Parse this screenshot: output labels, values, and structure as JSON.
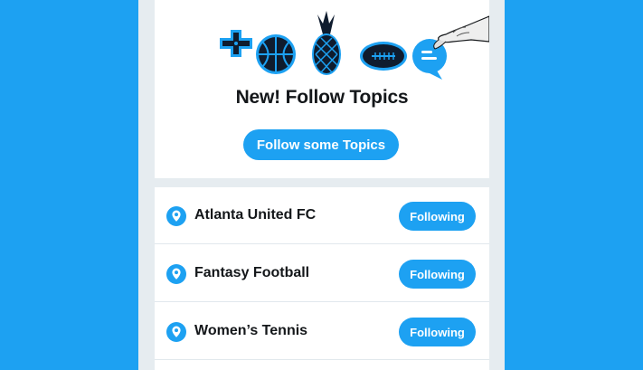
{
  "promo": {
    "headline": "New! Follow Topics",
    "cta_label": "Follow some Topics",
    "icons": [
      "gamepad-icon",
      "basketball-icon",
      "pineapple-icon",
      "football-icon",
      "chat-bubble-icon",
      "hand-icon"
    ]
  },
  "topics": [
    {
      "name": "Atlanta United FC",
      "button": "Following"
    },
    {
      "name": "Fantasy Football",
      "button": "Following"
    },
    {
      "name": "Women’s Tennis",
      "button": "Following"
    }
  ],
  "colors": {
    "brand": "#1DA1F2",
    "background": "#E6ECF0",
    "text": "#14171A",
    "illustration": "#0F1C2E"
  }
}
